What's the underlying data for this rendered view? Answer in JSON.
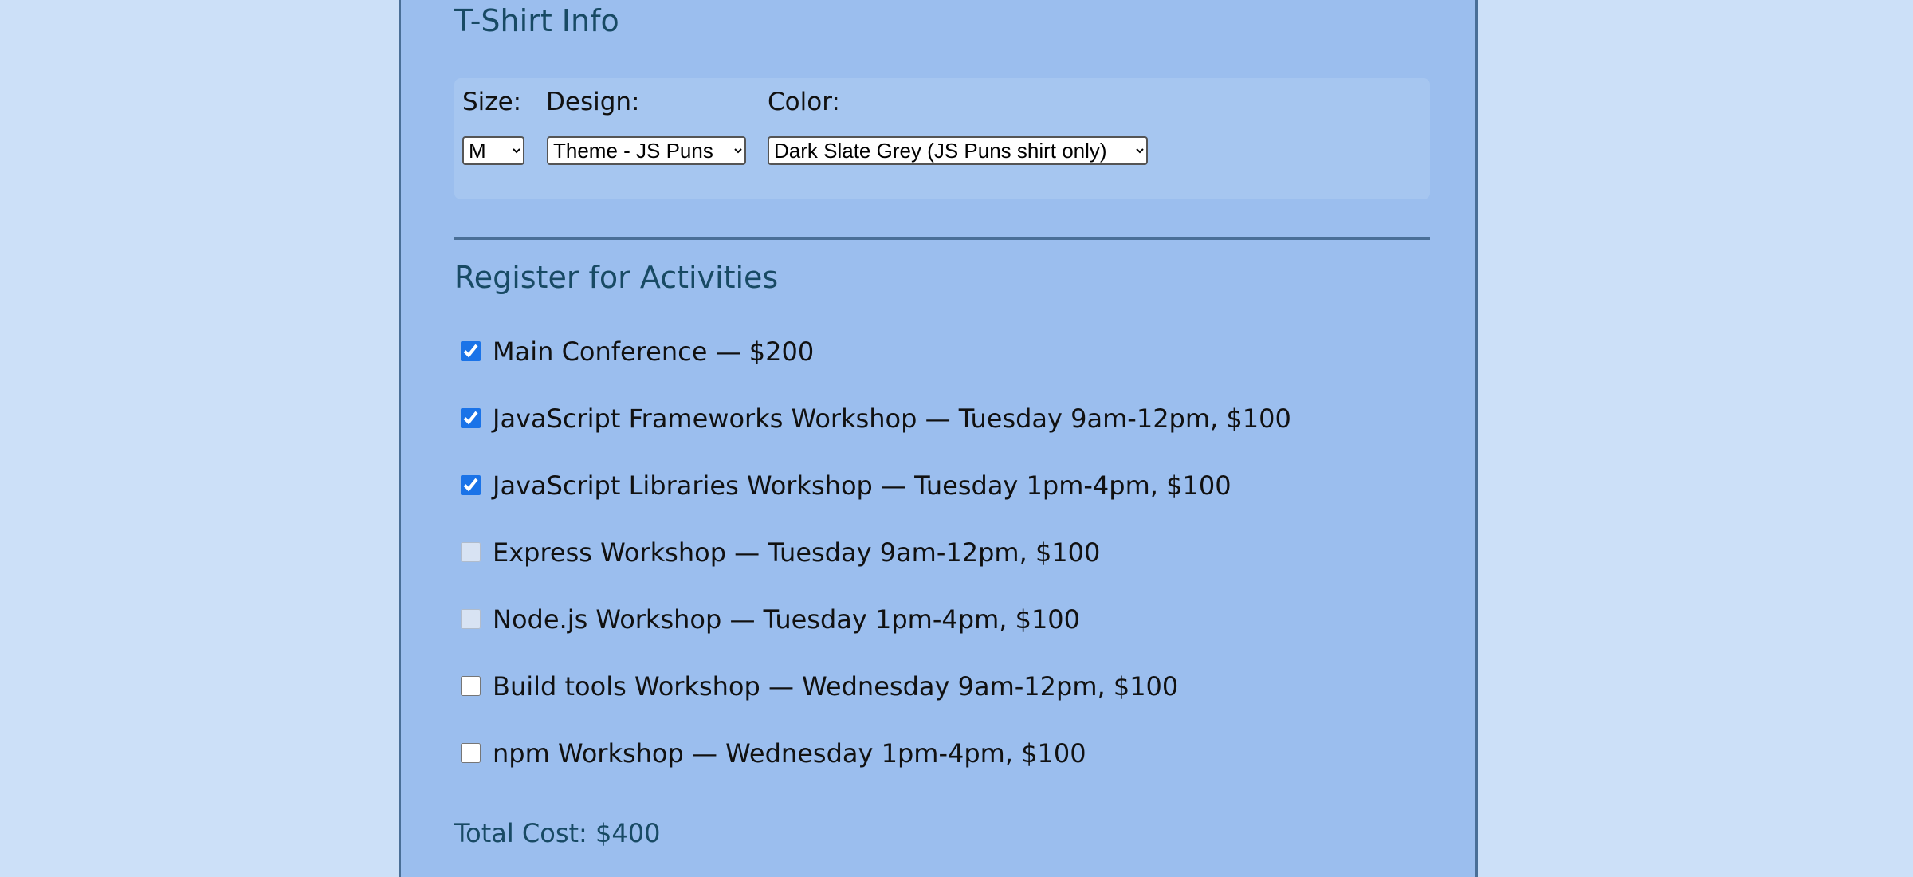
{
  "tshirt": {
    "title": "T-Shirt Info",
    "size_label": "Size:",
    "size_value": "M",
    "design_label": "Design:",
    "design_value": "Theme - JS Puns",
    "color_label": "Color:",
    "color_value": "Dark Slate Grey (JS Puns shirt only)"
  },
  "activities": {
    "title": "Register for Activities",
    "items": [
      {
        "label": "Main Conference — $200",
        "checked": true,
        "disabled": false
      },
      {
        "label": "JavaScript Frameworks Workshop — Tuesday 9am-12pm, $100",
        "checked": true,
        "disabled": false
      },
      {
        "label": "JavaScript Libraries Workshop — Tuesday 1pm-4pm, $100",
        "checked": true,
        "disabled": false
      },
      {
        "label": "Express Workshop — Tuesday 9am-12pm, $100",
        "checked": false,
        "disabled": true
      },
      {
        "label": "Node.js Workshop — Tuesday 1pm-4pm, $100",
        "checked": false,
        "disabled": true
      },
      {
        "label": "Build tools Workshop — Wednesday 9am-12pm, $100",
        "checked": false,
        "disabled": false
      },
      {
        "label": "npm Workshop — Wednesday 1pm-4pm, $100",
        "checked": false,
        "disabled": false
      }
    ],
    "total": "Total Cost: $400"
  },
  "colors": {
    "page_background": "#cce0f8",
    "panel_background": "#9bbeee",
    "heading_color": "#184a64",
    "checkbox_accent": "#1a73e8"
  }
}
